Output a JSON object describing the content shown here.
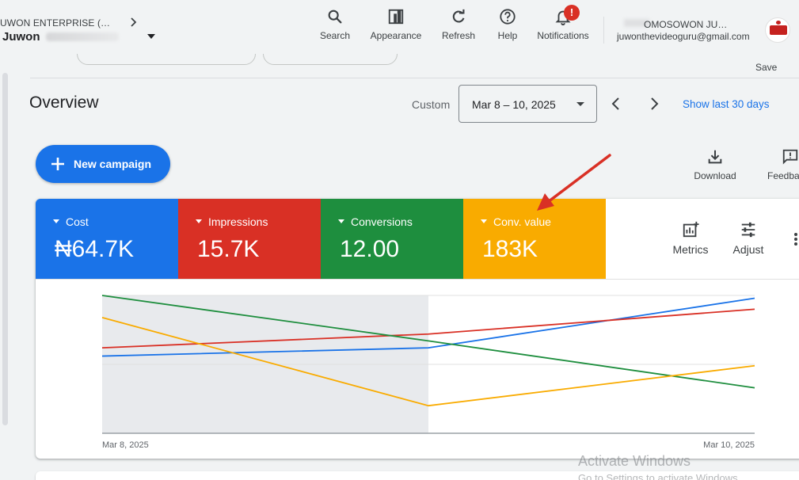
{
  "header": {
    "account_line1": "UWON ENTERPRISE (…",
    "account_name": "Juwon",
    "tools": [
      {
        "label": "Search",
        "icon": "search-icon"
      },
      {
        "label": "Appearance",
        "icon": "appearance-icon"
      },
      {
        "label": "Refresh",
        "icon": "refresh-icon"
      },
      {
        "label": "Help",
        "icon": "help-icon"
      },
      {
        "label": "Notifications",
        "icon": "bell-icon",
        "badge": "!"
      }
    ],
    "user_name": "OMOSOWON JU…",
    "user_email": "juwonthevideoguru@gmail.com"
  },
  "save_label": "Save",
  "overview": {
    "title": "Overview",
    "custom_label": "Custom",
    "date_range": "Mar 8 – 10, 2025",
    "show_last": "Show last 30 days"
  },
  "new_campaign_label": "New campaign",
  "aux_tools": [
    {
      "label": "Download",
      "icon": "download-icon"
    },
    {
      "label": "Feedba",
      "icon": "feedback-icon"
    }
  ],
  "metrics": [
    {
      "label": "Cost",
      "value": "₦64.7K",
      "color": "#1a73e8"
    },
    {
      "label": "Impressions",
      "value": "15.7K",
      "color": "#d93025"
    },
    {
      "label": "Conversions",
      "value": "12.00",
      "color": "#1e8e3e"
    },
    {
      "label": "Conv. value",
      "value": "183K",
      "color": "#f9ab00"
    }
  ],
  "card_tools": [
    {
      "label": "Metrics",
      "icon": "add-chart-icon"
    },
    {
      "label": "Adjust",
      "icon": "tune-icon"
    }
  ],
  "chart_data": {
    "type": "line",
    "x": [
      "Mar 8, 2025",
      "Mar 9, 2025",
      "Mar 10, 2025"
    ],
    "x_tick_labels": [
      "Mar 8, 2025",
      "Mar 10, 2025"
    ],
    "normalized_scale": true,
    "ylim": [
      0,
      1
    ],
    "shaded_region": [
      "Mar 8, 2025",
      "Mar 9, 2025"
    ],
    "series": [
      {
        "metric": "Cost",
        "color": "#1a73e8",
        "values": [
          0.56,
          0.62,
          0.98
        ]
      },
      {
        "metric": "Impressions",
        "color": "#d93025",
        "values": [
          0.62,
          0.72,
          0.9
        ]
      },
      {
        "metric": "Conversions",
        "color": "#1e8e3e",
        "values": [
          1.0,
          0.67,
          0.33
        ]
      },
      {
        "metric": "Conv. value",
        "color": "#f9ab00",
        "values": [
          0.84,
          0.2,
          0.49
        ]
      }
    ]
  },
  "watermark": {
    "line1": "Activate Windows",
    "line2": "Go to Settings to activate Windows."
  }
}
